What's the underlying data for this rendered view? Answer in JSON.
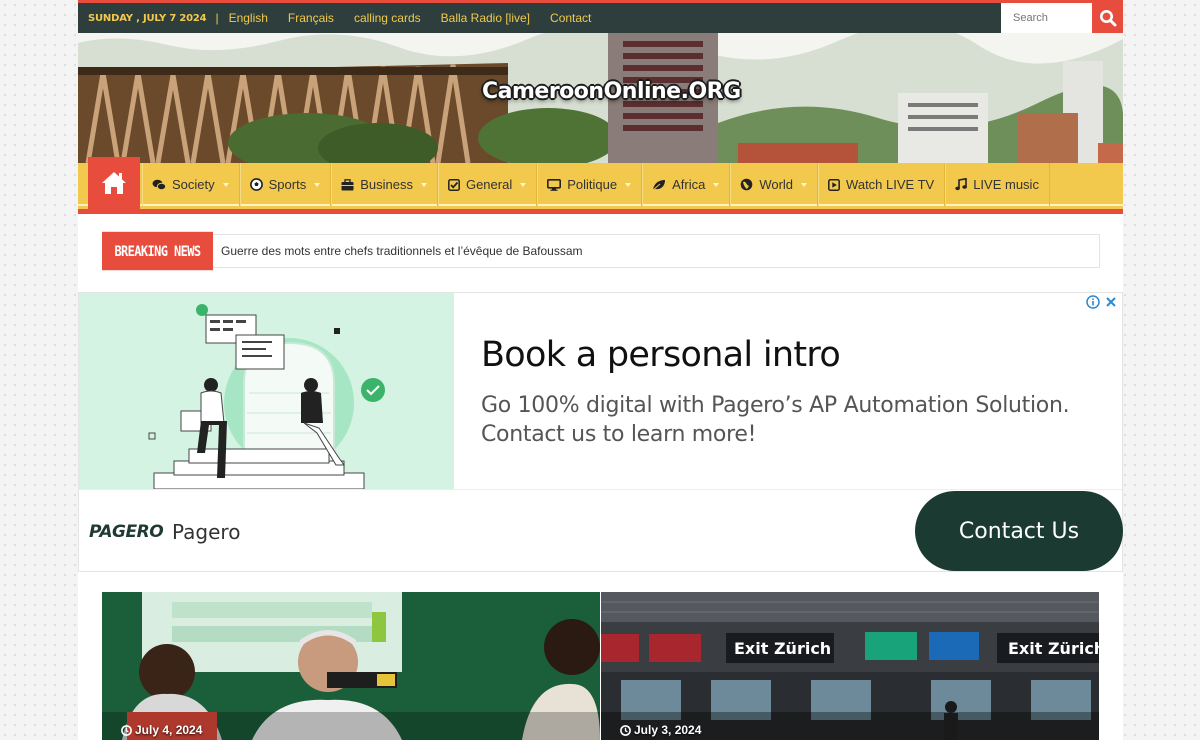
{
  "topbar": {
    "date": "SUNDAY , JULY 7 2024",
    "separator": "|",
    "links": [
      "English",
      "Français",
      "calling cards",
      "Balla Radio [live]",
      "Contact"
    ],
    "search_placeholder": "Search"
  },
  "header": {
    "logo_text": "CameroonOnline.ORG"
  },
  "nav": {
    "items": [
      {
        "label": "Society",
        "icon": "comments-icon",
        "dropdown": true
      },
      {
        "label": "Sports",
        "icon": "soccer-ball-icon",
        "dropdown": true
      },
      {
        "label": "Business",
        "icon": "briefcase-icon",
        "dropdown": true
      },
      {
        "label": "General",
        "icon": "check-square-icon",
        "dropdown": true
      },
      {
        "label": "Politique",
        "icon": "desktop-icon",
        "dropdown": true
      },
      {
        "label": "Africa",
        "icon": "leaf-icon",
        "dropdown": true
      },
      {
        "label": "World",
        "icon": "globe-icon",
        "dropdown": true
      },
      {
        "label": "Watch LIVE TV",
        "icon": "play-square-icon",
        "dropdown": false
      },
      {
        "label": "LIVE music",
        "icon": "music-icon",
        "dropdown": false
      }
    ]
  },
  "breaking": {
    "label": "BREAKING NEWS",
    "headline": "Guerre des mots entre chefs traditionnels et l’évêque de Bafoussam"
  },
  "ad": {
    "headline": "Book a personal intro",
    "body": "Go 100% digital with Pagero’s AP Automation Solution. Contact us to learn more!",
    "brand_logo": "PAGERO",
    "brand_name": "Pagero",
    "cta": "Contact Us"
  },
  "news": [
    {
      "date": "July 4, 2024"
    },
    {
      "date": "July 3, 2024",
      "sign_text": "Exit Zürich"
    }
  ],
  "colors": {
    "accent_red": "#e74c3c",
    "nav_yellow": "#f2c94c",
    "topbar_dark": "#2d3e3c",
    "ad_dark_green": "#1b3a32"
  }
}
